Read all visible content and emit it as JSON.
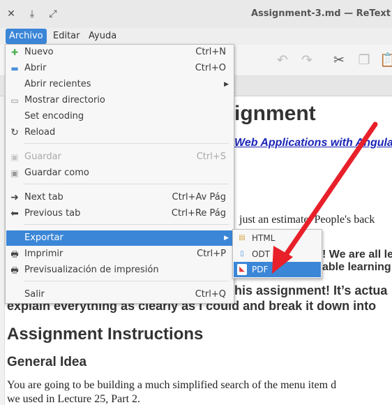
{
  "window": {
    "title": "Assignment-3.md — ReText"
  },
  "menubar": {
    "items": [
      {
        "label": "Archivo"
      },
      {
        "label": "Editar"
      },
      {
        "label": "Ayuda"
      }
    ]
  },
  "file_menu": {
    "items": [
      {
        "label": "Nuevo",
        "shortcut": "Ctrl+N"
      },
      {
        "label": "Abrir",
        "shortcut": "Ctrl+O"
      },
      {
        "label": "Abrir recientes",
        "shortcut": ""
      },
      {
        "label": "Mostrar directorio",
        "shortcut": ""
      },
      {
        "label": "Set encoding",
        "shortcut": ""
      },
      {
        "label": "Reload",
        "shortcut": ""
      },
      {
        "label": "Guardar",
        "shortcut": "Ctrl+S"
      },
      {
        "label": "Guardar como",
        "shortcut": ""
      },
      {
        "label": "Next tab",
        "shortcut": "Ctrl+Av Pág"
      },
      {
        "label": "Previous tab",
        "shortcut": "Ctrl+Re Pág"
      },
      {
        "label": "Exportar",
        "shortcut": ""
      },
      {
        "label": "Imprimir",
        "shortcut": "Ctrl+P"
      },
      {
        "label": "Previsualización de impresión",
        "shortcut": ""
      },
      {
        "label": "Salir",
        "shortcut": "Ctrl+Q"
      }
    ]
  },
  "export_menu": {
    "items": [
      {
        "label": "HTML"
      },
      {
        "label": "ODT"
      },
      {
        "label": "PDF"
      }
    ]
  },
  "document": {
    "title_fragment": "ignment",
    "link_fragment": "Web Applications with Angula",
    "line1": "just an estimate. People's back",
    "line2": "! We are all le",
    "line3": "able learning",
    "line4": "his assignment! It’s actua",
    "line5": "explain everything as clearly as I could and break it down into",
    "heading2": "Assignment Instructions",
    "heading3": "General Idea",
    "para1": "You are going to be building a much simplified search of the menu item d",
    "para2": "we used in Lecture 25, Part 2."
  },
  "colors": {
    "accent": "#3b86d7",
    "annotation_arrow": "#e8202a",
    "link": "#1a24b6"
  }
}
